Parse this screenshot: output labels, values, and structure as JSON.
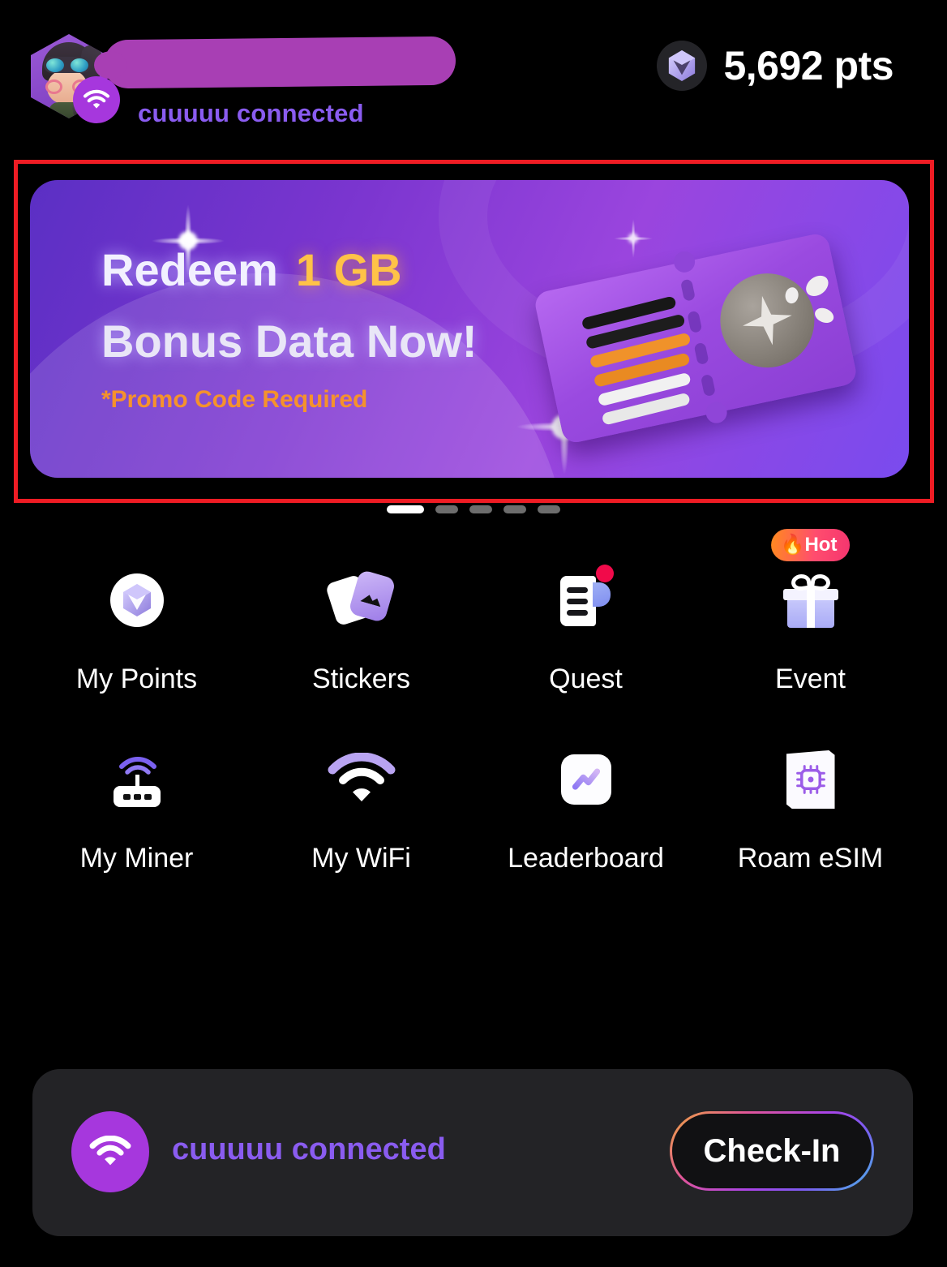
{
  "header": {
    "avatar_name": "avatar",
    "username_redacted": "",
    "status_text": "cuuuuu connected",
    "points_value": "5,692 pts",
    "points_icon": "cube-gem-icon",
    "wifi_badge_icon": "wifi-icon"
  },
  "banner": {
    "title_prefix": "Redeem",
    "title_highlight": "1 GB",
    "title_second_line": "Bonus Data Now!",
    "promo_note": "*Promo Code Required",
    "illustration": "coupon-ticket-icon",
    "highlight_color": "#ffc247",
    "promo_color": "#f5922c"
  },
  "carousel": {
    "total": 5,
    "active_index": 0
  },
  "grid": {
    "items": [
      {
        "label": "My Points",
        "icon": "cube-gem-icon",
        "badge": "",
        "dot": false
      },
      {
        "label": "Stickers",
        "icon": "sticker-cards-icon",
        "badge": "",
        "dot": false
      },
      {
        "label": "Quest",
        "icon": "quest-scroll-icon",
        "badge": "",
        "dot": true
      },
      {
        "label": "Event",
        "icon": "gift-box-icon",
        "badge": "🔥Hot",
        "dot": false
      },
      {
        "label": "My Miner",
        "icon": "router-icon",
        "badge": "",
        "dot": false
      },
      {
        "label": "My WiFi",
        "icon": "wifi-icon",
        "badge": "",
        "dot": false
      },
      {
        "label": "Leaderboard",
        "icon": "trend-chart-icon",
        "badge": "",
        "dot": false
      },
      {
        "label": "Roam eSIM",
        "icon": "sim-chip-icon",
        "badge": "",
        "dot": false
      }
    ]
  },
  "connection_bar": {
    "icon": "wifi-icon",
    "status_text": "cuuuuu connected",
    "button_label": "Check-In"
  },
  "colors": {
    "background": "#000000",
    "accent_purple": "#8a5cf0",
    "wifi_purple": "#a637dd",
    "annotation_red": "#ef1c24",
    "hot_badge_gradient_start": "#ff8a1e",
    "hot_badge_gradient_end": "#f5356f"
  }
}
